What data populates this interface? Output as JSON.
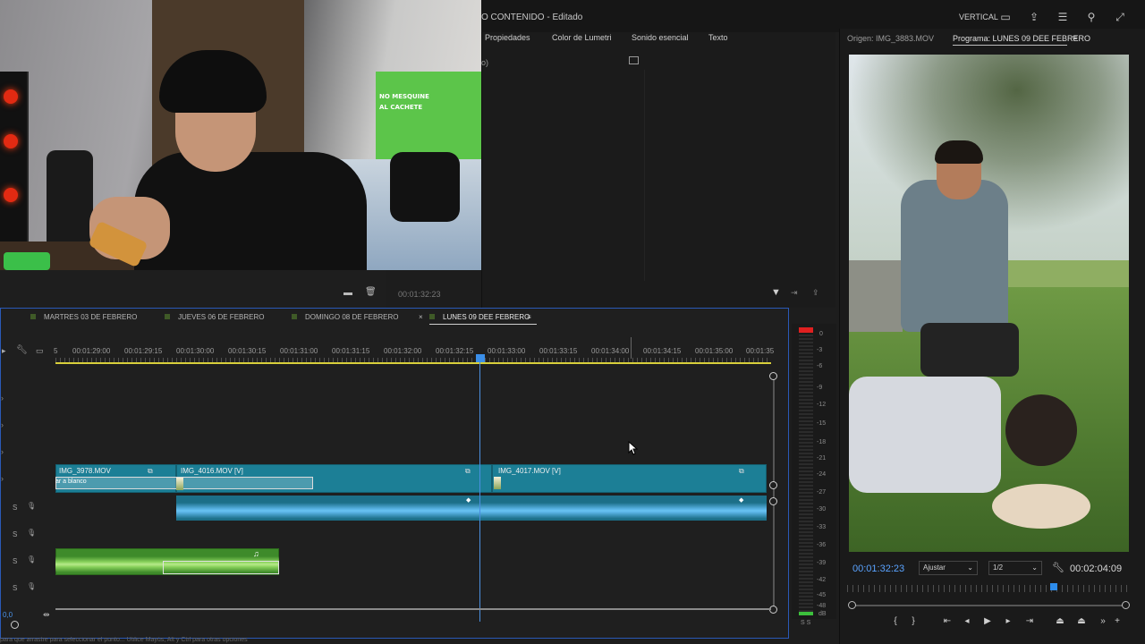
{
  "header": {
    "title": "O CONTENIDO - Editado",
    "layout": "VERTICAL"
  },
  "properties_panel": {
    "tabs": [
      "Propiedades",
      "Color de Lumetri",
      "Sonido esencial",
      "Texto"
    ],
    "sub_text": "o)"
  },
  "bin": {
    "timecode": "00:01:32:23"
  },
  "monitor": {
    "source_label": "Origen: IMG_3883.MOV",
    "program_label": "Programa: LUNES 09 DEE FEBRERO",
    "timecode": "00:01:32:23",
    "fit": "Ajustar",
    "resolution": "1/2",
    "duration": "00:02:04:09",
    "playhead_fraction": 0.73
  },
  "timeline": {
    "sequences": [
      "MARTRES 03 DE FEBRERO",
      "JUEVES 06 DE FEBRERO",
      "DOMINGO 08 DE FEBRERO",
      "LUNES 09 DEE FEBRERO"
    ],
    "active_sequence": "LUNES 09 DEE FEBRERO",
    "ruler_prefix": "5",
    "ruler_times": [
      "00:01:29:00",
      "00:01:29:15",
      "00:01:30:00",
      "00:01:30:15",
      "00:01:31:00",
      "00:01:31:15",
      "00:01:32:00",
      "00:01:32:15",
      "00:01:33:00",
      "00:01:33:15",
      "00:01:34:00",
      "00:01:34:15",
      "00:01:35:00",
      "00:01:35"
    ],
    "video_clips": [
      {
        "name": "IMG_3978.MOV"
      },
      {
        "name": "IMG_4016.MOV [V]"
      },
      {
        "name": "IMG_4017.MOV [V]"
      }
    ],
    "transition_label": "ar a blanco",
    "audio_track_labels": [
      "S",
      "S",
      "S",
      "S"
    ],
    "zoom": "0,0"
  },
  "meters": {
    "scale": [
      "0",
      "-3",
      "-6",
      "-9",
      "-12",
      "-15",
      "-18",
      "-21",
      "-24",
      "-27",
      "-30",
      "-33",
      "-36",
      "-39",
      "-42",
      "-45",
      "-48",
      "dB"
    ],
    "solo_labels": "S S"
  },
  "status": {
    "text": "para que arrastre para seleccionar el punto... Utilice Mayús, Alt y Ctrl para otras opciones"
  },
  "webcam": {
    "banner_lines": [
      "NO MESQUINE",
      "AL CACHETE"
    ]
  },
  "colors": {
    "accent_blue": "#4b8fe0",
    "video_clip": "#1c7f96",
    "audio_music": "#3e8a2a"
  }
}
